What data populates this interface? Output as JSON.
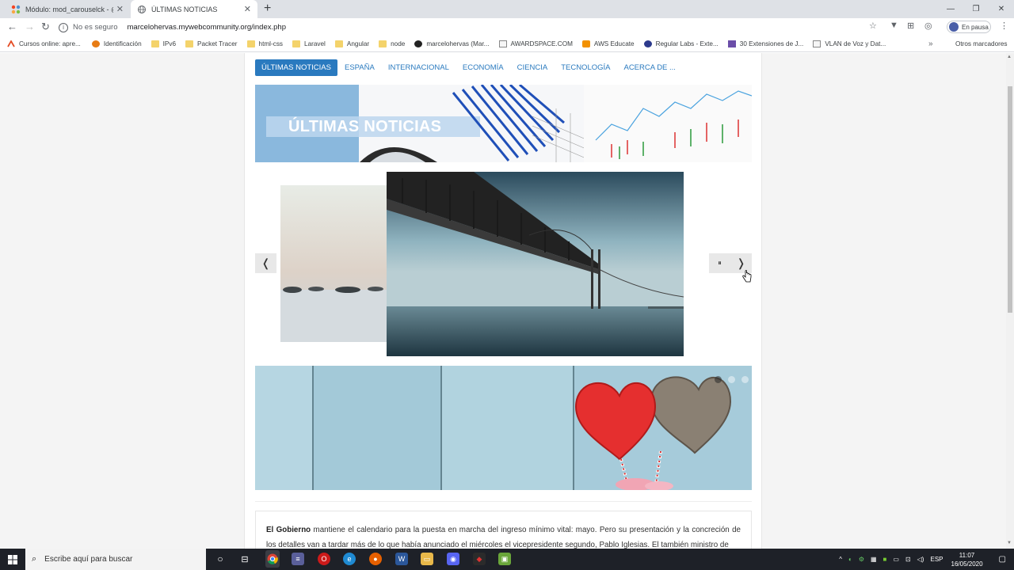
{
  "browser": {
    "tabs": [
      {
        "title": "Módulo: mod_carouselck - @INF",
        "active": false
      },
      {
        "title": "ÚLTIMAS NOTICIAS",
        "active": true
      }
    ],
    "security_label": "No es seguro",
    "url": "marcelohervas.mywebcommunity.org/index.php",
    "profile_label": "En pausa",
    "bookmarks": [
      {
        "label": "Cursos online: apre...",
        "icon": "red-logo-icon"
      },
      {
        "label": "Identificación",
        "icon": "orange-circle-icon"
      },
      {
        "label": "IPv6",
        "icon": "folder-icon"
      },
      {
        "label": "Packet Tracer",
        "icon": "folder-icon"
      },
      {
        "label": "html-css",
        "icon": "folder-icon"
      },
      {
        "label": "Laravel",
        "icon": "folder-icon"
      },
      {
        "label": "Angular",
        "icon": "folder-icon"
      },
      {
        "label": "node",
        "icon": "folder-icon"
      },
      {
        "label": "marcelohervas (Mar...",
        "icon": "github-icon"
      },
      {
        "label": "AWARDSPACE.COM",
        "icon": "page-icon"
      },
      {
        "label": "AWS Educate",
        "icon": "aws-icon"
      },
      {
        "label": "Regular Labs - Exte...",
        "icon": "regular-labs-icon"
      },
      {
        "label": "30 Extensiones de J...",
        "icon": "purple-square-icon"
      },
      {
        "label": "VLAN de Voz y Dat...",
        "icon": "page-icon"
      }
    ],
    "other_bookmarks": "Otros marcadores"
  },
  "site": {
    "menu": [
      "ÚLTIMAS NOTICIAS",
      "ESPAÑA",
      "INTERNACIONAL",
      "ECONOMÍA",
      "CIENCIA",
      "TECNOLOGÍA",
      "ACERCA DE ..."
    ],
    "banner_title": "ÚLTIMAS NOTICIAS",
    "carousel": {
      "prev": "❬",
      "pause": "⏸",
      "next": "❭"
    },
    "dots": {
      "count": 3,
      "active": 0
    },
    "article": {
      "lead": "El Gobierno",
      "text": " mantiene el calendario para la puesta en marcha del ingreso mínimo vital: mayo. Pero su presentación y la concreción de los detalles van a tardar más de lo que había anunciado el miércoles el vicepresidente segundo, Pablo Iglesias. El también ministro de"
    }
  },
  "taskbar": {
    "search_placeholder": "Escribe aquí para buscar",
    "lang": "ESP",
    "time": "11:07",
    "date": "16/05/2020"
  },
  "colors": {
    "accent": "#2a7abf",
    "taskbar": "#1e2128"
  }
}
